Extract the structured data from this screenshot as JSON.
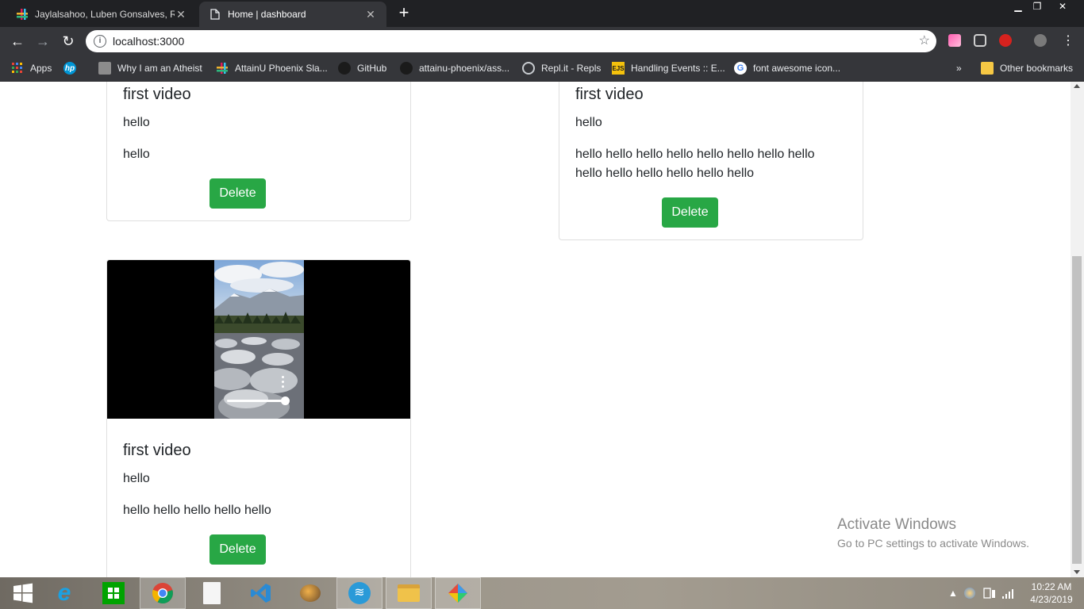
{
  "browser": {
    "tabs": [
      {
        "title": "Jaylalsahoo, Luben Gonsalves, Ra",
        "active": false
      },
      {
        "title": "Home | dashboard",
        "active": true
      }
    ],
    "address": "localhost:3000",
    "apps_label": "Apps",
    "bookmarks": [
      {
        "label": "Why I am an Atheist",
        "icon": "book-icon"
      },
      {
        "label": "AttainU Phoenix Sla...",
        "icon": "slack-icon"
      },
      {
        "label": "GitHub",
        "icon": "github-icon"
      },
      {
        "label": "attainu-phoenix/ass...",
        "icon": "github-icon"
      },
      {
        "label": "Repl.it - Repls",
        "icon": "replit-icon"
      },
      {
        "label": "Handling Events :: E...",
        "icon": "ejs-icon"
      },
      {
        "label": "font awesome icon...",
        "icon": "google-icon"
      }
    ],
    "more_bookmarks": "»",
    "other_bookmarks": "Other bookmarks"
  },
  "page": {
    "cards": [
      {
        "title": "first video",
        "subtitle": "hello",
        "text": "hello",
        "delete_label": "Delete"
      },
      {
        "title": "first video",
        "subtitle": "hello",
        "text": "hello hello hello hello hello hello hello hello hello hello hello hello hello hello",
        "delete_label": "Delete"
      },
      {
        "title": "first video",
        "subtitle": "hello",
        "text": "hello hello hello hello hello",
        "delete_label": "Delete"
      }
    ]
  },
  "watermark": {
    "line1": "Activate Windows",
    "line2": "Go to PC settings to activate Windows."
  },
  "taskbar": {
    "apps": [
      "start-icon",
      "internet-explorer-icon",
      "windows-store-icon",
      "chrome-icon",
      "file-icon",
      "vscode-icon",
      "network-tool-icon",
      "wifi-tool-icon",
      "file-explorer-icon",
      "gem-icon"
    ],
    "time": "10:22 AM",
    "date": "4/23/2019"
  },
  "colors": {
    "tab_strip": "#202124",
    "toolbar": "#35363a",
    "delete_button": "#28a745",
    "text": "#212529"
  }
}
